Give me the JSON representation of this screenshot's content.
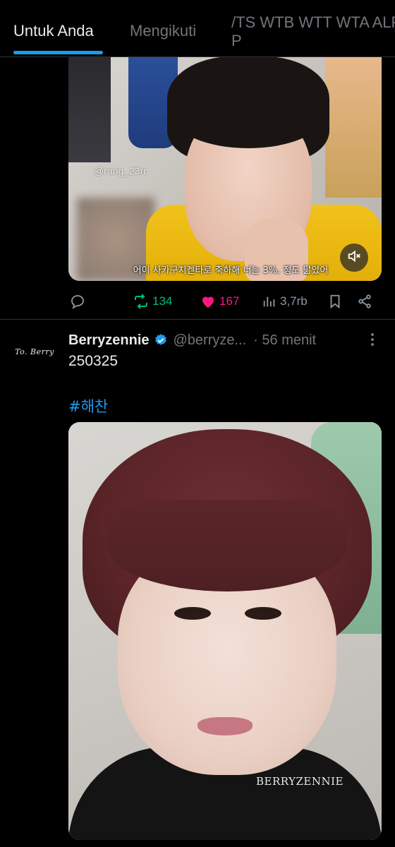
{
  "tabs": [
    {
      "label": "Untuk Anda",
      "active": true
    },
    {
      "label": "Mengikuti",
      "active": false
    },
    {
      "label": "/TS WTB WTT WTA ALPOP",
      "active": false
    }
  ],
  "colors": {
    "accent": "#1d9bf0",
    "retweet": "#00ba7c",
    "like": "#f91880",
    "muted": "#71767b",
    "background": "#000000"
  },
  "tweet1": {
    "media": {
      "watermark": "@rang_23rr",
      "subtitle": "어이 사카구치켄타로 축하해 너는 3%. 정도 닮았어",
      "mute_icon": "volume-mute-icon"
    },
    "actions": {
      "retweets": "134",
      "likes": "167",
      "views": "3,7rb"
    }
  },
  "tweet2": {
    "avatar_text": "To. Berry",
    "display_name": "Berryzennie",
    "handle": "@berryze...",
    "time": "· 56 menit",
    "text": "250325",
    "hashtag": "#해찬",
    "media_watermark": "BERRYZENNIE"
  }
}
